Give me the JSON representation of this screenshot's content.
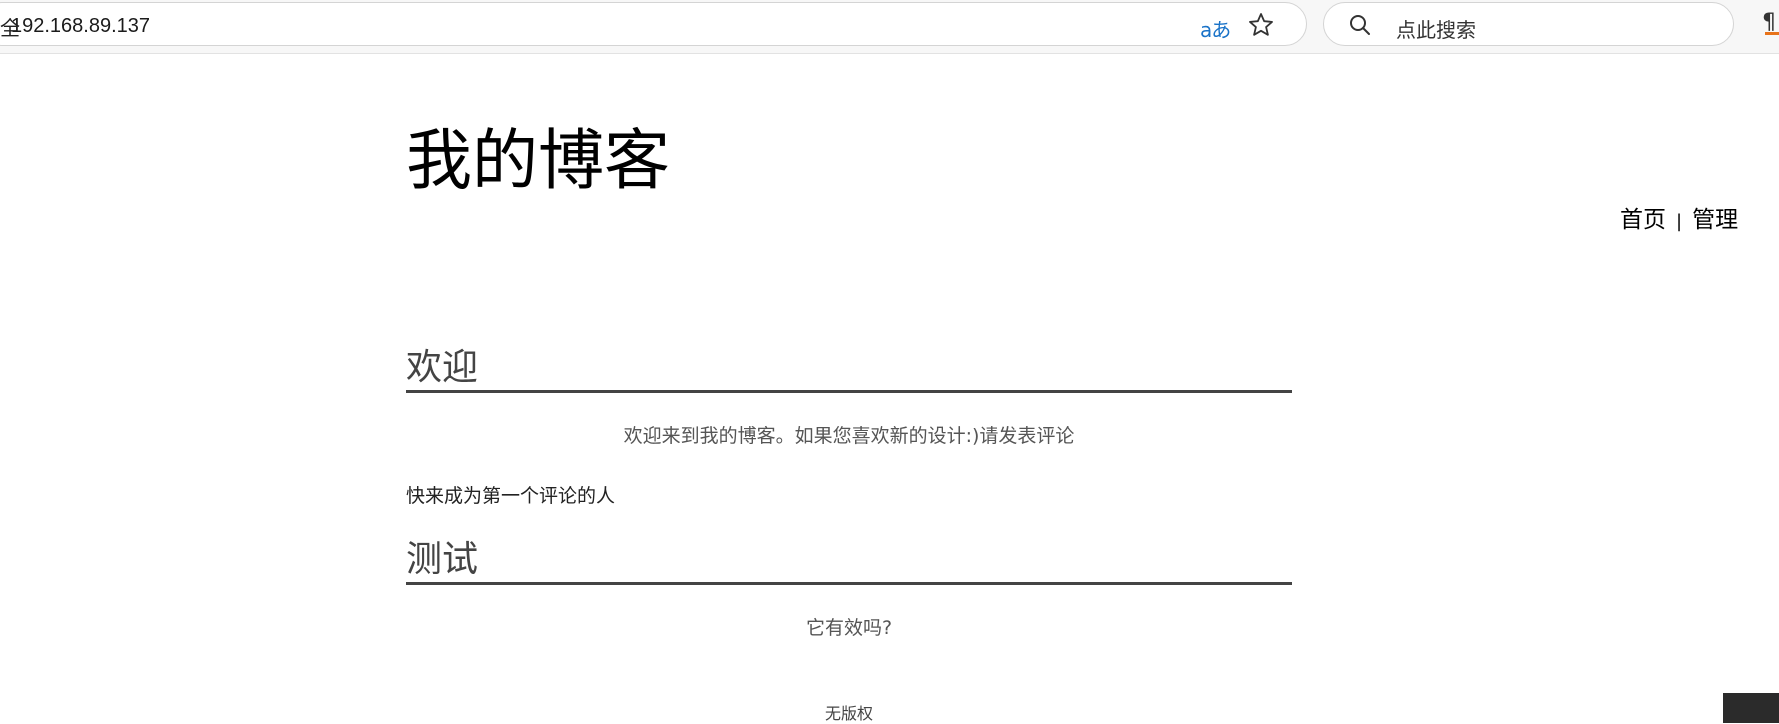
{
  "browser": {
    "left_fragment": "全",
    "url": "192.168.89.137",
    "translate_icon_text": "aあ",
    "search_placeholder": "点此搜索",
    "extension_glyph": "¶"
  },
  "site": {
    "title": "我的博客",
    "nav": [
      {
        "label": "首页"
      },
      {
        "label": "管理"
      }
    ],
    "nav_separator": "|"
  },
  "posts": [
    {
      "title": "欢迎",
      "body": "欢迎来到我的博客。如果您喜欢新的设计:)请发表评论"
    },
    {
      "title": "测试",
      "body": "它有效吗?"
    }
  ],
  "comment_prompt": "快来成为第一个评论的人",
  "footer": {
    "text": "无版权"
  },
  "colors": {
    "accent_translate": "#1a73c8",
    "extension_accent": "#e8731a",
    "rule": "#444444"
  }
}
